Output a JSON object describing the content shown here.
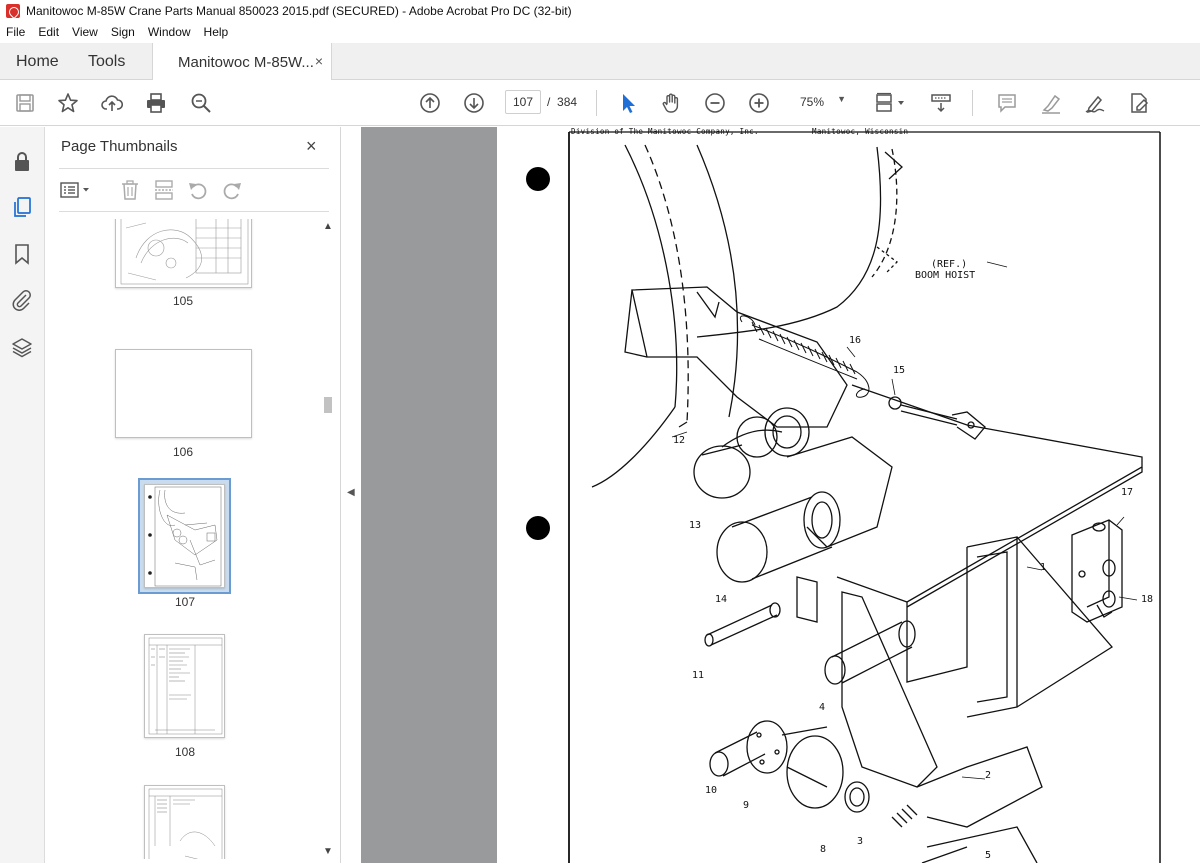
{
  "window": {
    "title": "Manitowoc M-85W Crane Parts Manual 850023 2015.pdf (SECURED) - Adobe Acrobat Pro DC (32-bit)"
  },
  "menu": [
    "File",
    "Edit",
    "View",
    "Sign",
    "Window",
    "Help"
  ],
  "tabs": {
    "home": "Home",
    "tools": "Tools",
    "document": "Manitowoc M-85W...",
    "document_close": "×"
  },
  "toolbar": {
    "current_page": "107",
    "page_separator": "/",
    "total_pages": "384",
    "zoom": "75%",
    "icons": [
      "save-icon",
      "bookmark-star-icon",
      "upload-icon",
      "print-icon",
      "zoom-search-icon",
      "page-up-icon",
      "page-down-icon",
      "select-cursor-icon",
      "hand-icon",
      "zoom-out-icon",
      "zoom-in-icon",
      "page-layout-icon",
      "scrolling-icon",
      "comment-icon",
      "highlight-icon",
      "sign-icon",
      "edit-pdf-icon"
    ]
  },
  "leftrail": {
    "icons": [
      "lock-icon",
      "pages-icon",
      "bookmark-icon",
      "attachment-icon",
      "layers-icon"
    ]
  },
  "thumbnails_panel": {
    "title": "Page Thumbnails",
    "close": "×",
    "thumbs": [
      {
        "label": "105",
        "selected": false
      },
      {
        "label": "106",
        "selected": false
      },
      {
        "label": "107",
        "selected": true
      },
      {
        "label": "108",
        "selected": false
      },
      {
        "label": "",
        "selected": false
      }
    ]
  },
  "document": {
    "header_left": "Division of The Manitowoc Company, Inc.",
    "header_right": "Manitowoc, Wisconsin",
    "ref_label_line1": "(REF.)",
    "ref_label_line2": "BOOM HOIST",
    "callouts": [
      "16",
      "15",
      "12",
      "13",
      "17",
      "1",
      "14",
      "18",
      "11",
      "4",
      "2",
      "10",
      "9",
      "8",
      "3",
      "5"
    ]
  }
}
